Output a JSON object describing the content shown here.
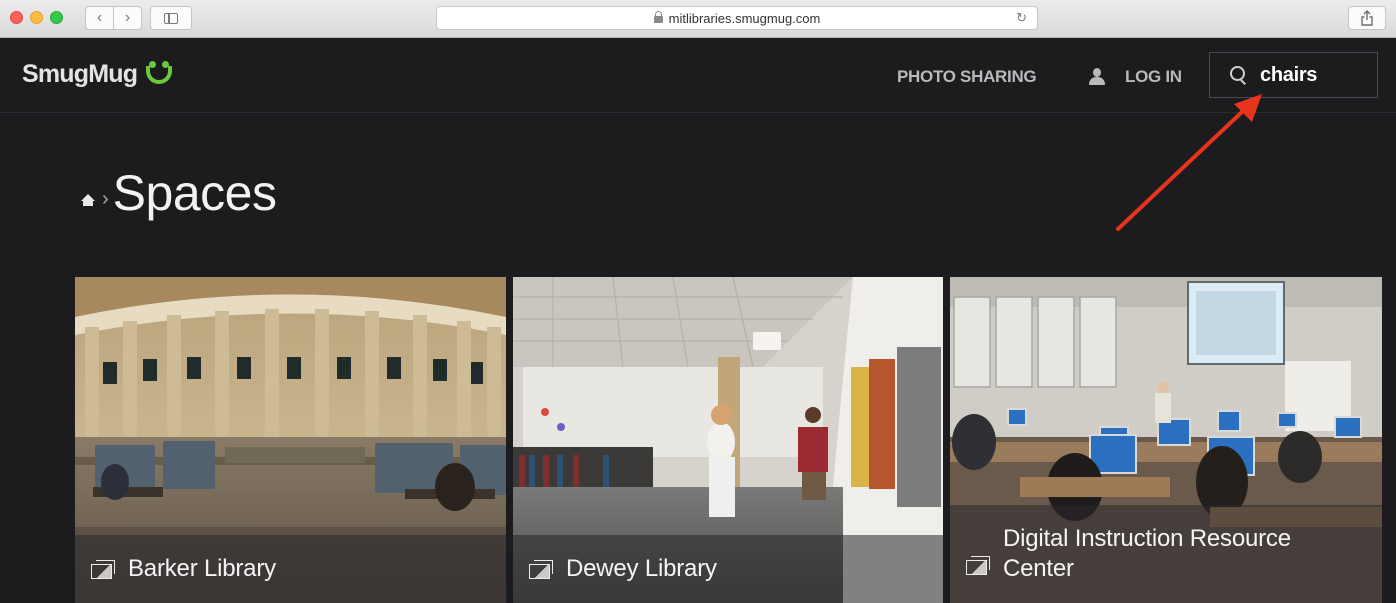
{
  "browser": {
    "url": "mitlibraries.smugmug.com"
  },
  "header": {
    "logo_text": "SmugMug",
    "nav": {
      "photo_sharing": "PHOTO SHARING",
      "log_in": "LOG IN"
    },
    "search": {
      "value": "chairs"
    }
  },
  "breadcrumb": {
    "title": "Spaces"
  },
  "gallery": {
    "items": [
      {
        "label": "Barker Library"
      },
      {
        "label": "Dewey Library"
      },
      {
        "label": "Digital Instruction Resource Center"
      }
    ]
  },
  "annotation": {
    "arrow_color": "#e8341c"
  },
  "colors": {
    "brand_green": "#6bc93e",
    "background": "#1c1c1f"
  }
}
